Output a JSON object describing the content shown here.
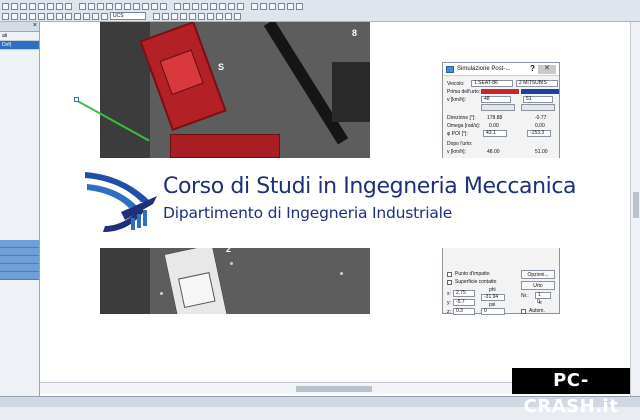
{
  "toolbar": {
    "coord_system": "UCS"
  },
  "sidebar": {
    "items": [
      "ati",
      "Def)"
    ]
  },
  "dialog": {
    "title": "Simulazione Post-...",
    "help_label": "?",
    "close_label": "✕",
    "vehicle_label": "Veicolo:",
    "vehicle_1": "1 SEAT-86",
    "vehicle_2": "2 MITSUBIS",
    "vehicle_1_color": "#c8282d",
    "vehicle_2_color": "#1f3fa0",
    "before_label": "Prima dell'urto:",
    "v_label": "v [km/h]:",
    "v1": "48",
    "v2": "51",
    "direction_label": "Direzione [°]:",
    "direction_1": "178.88",
    "direction_2": "-0.77",
    "omega_label": "Omega [rad/s]:",
    "omega_1": "0.00",
    "omega_2": "0.00",
    "poi_label": "φ POI [°]:",
    "poi_1": "43.1",
    "poi_2": "-153.3",
    "after_label": "Dopo l'urto:",
    "v_after_label": "v [km/h]:",
    "v_after_1": "48.00",
    "v_after_2": "51.00",
    "impact_point_label": "Punto d'impatto",
    "contact_surface_label": "Superficie contatto",
    "options_button": "Opzioni...",
    "unit_button": "Urto",
    "x_label": "x:",
    "x_value": "2.75",
    "y_label": "y:",
    "y_value": "-5.7",
    "z_label": "z:",
    "z_value": "0.3",
    "phi_label": "phi",
    "phi_value": "-31.94",
    "psi_label": "psi",
    "psi_value": "0",
    "e_label": "e",
    "e_value": "0",
    "nr_label": "Nr.:",
    "nr_value": "1",
    "auto_label": "Autom."
  },
  "banner": {
    "title": "Corso di Studi in Ingegneria Meccanica",
    "subtitle": "Dipartimento di Ingegneria Industriale"
  },
  "markers": [
    "S",
    "8",
    "2"
  ],
  "watermark": "PC-CRASH.it"
}
